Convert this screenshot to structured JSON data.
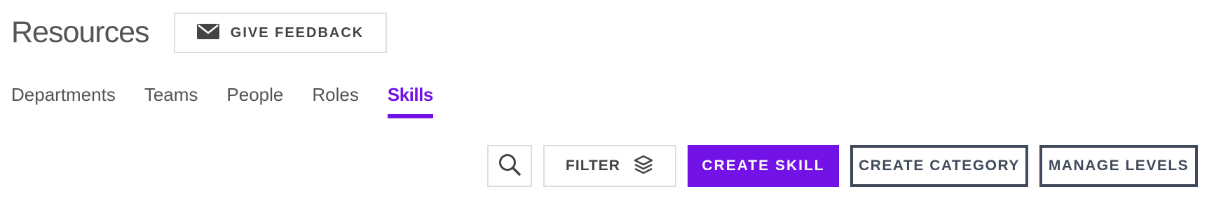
{
  "header": {
    "title": "Resources",
    "feedback_label": "GIVE FEEDBACK"
  },
  "tabs": [
    {
      "label": "Departments",
      "active": false
    },
    {
      "label": "Teams",
      "active": false
    },
    {
      "label": "People",
      "active": false
    },
    {
      "label": "Roles",
      "active": false
    },
    {
      "label": "Skills",
      "active": true
    }
  ],
  "toolbar": {
    "filter_label": "FILTER",
    "create_skill_label": "CREATE SKILL",
    "create_category_label": "CREATE CATEGORY",
    "manage_levels_label": "MANAGE LEVELS"
  },
  "icons": {
    "feedback": "envelope-icon",
    "search": "search-icon",
    "filter": "layers-icon"
  },
  "colors": {
    "accent": "#7212e6",
    "outline": "#3f4b5a",
    "text": "#555555",
    "border": "#dddddd"
  }
}
